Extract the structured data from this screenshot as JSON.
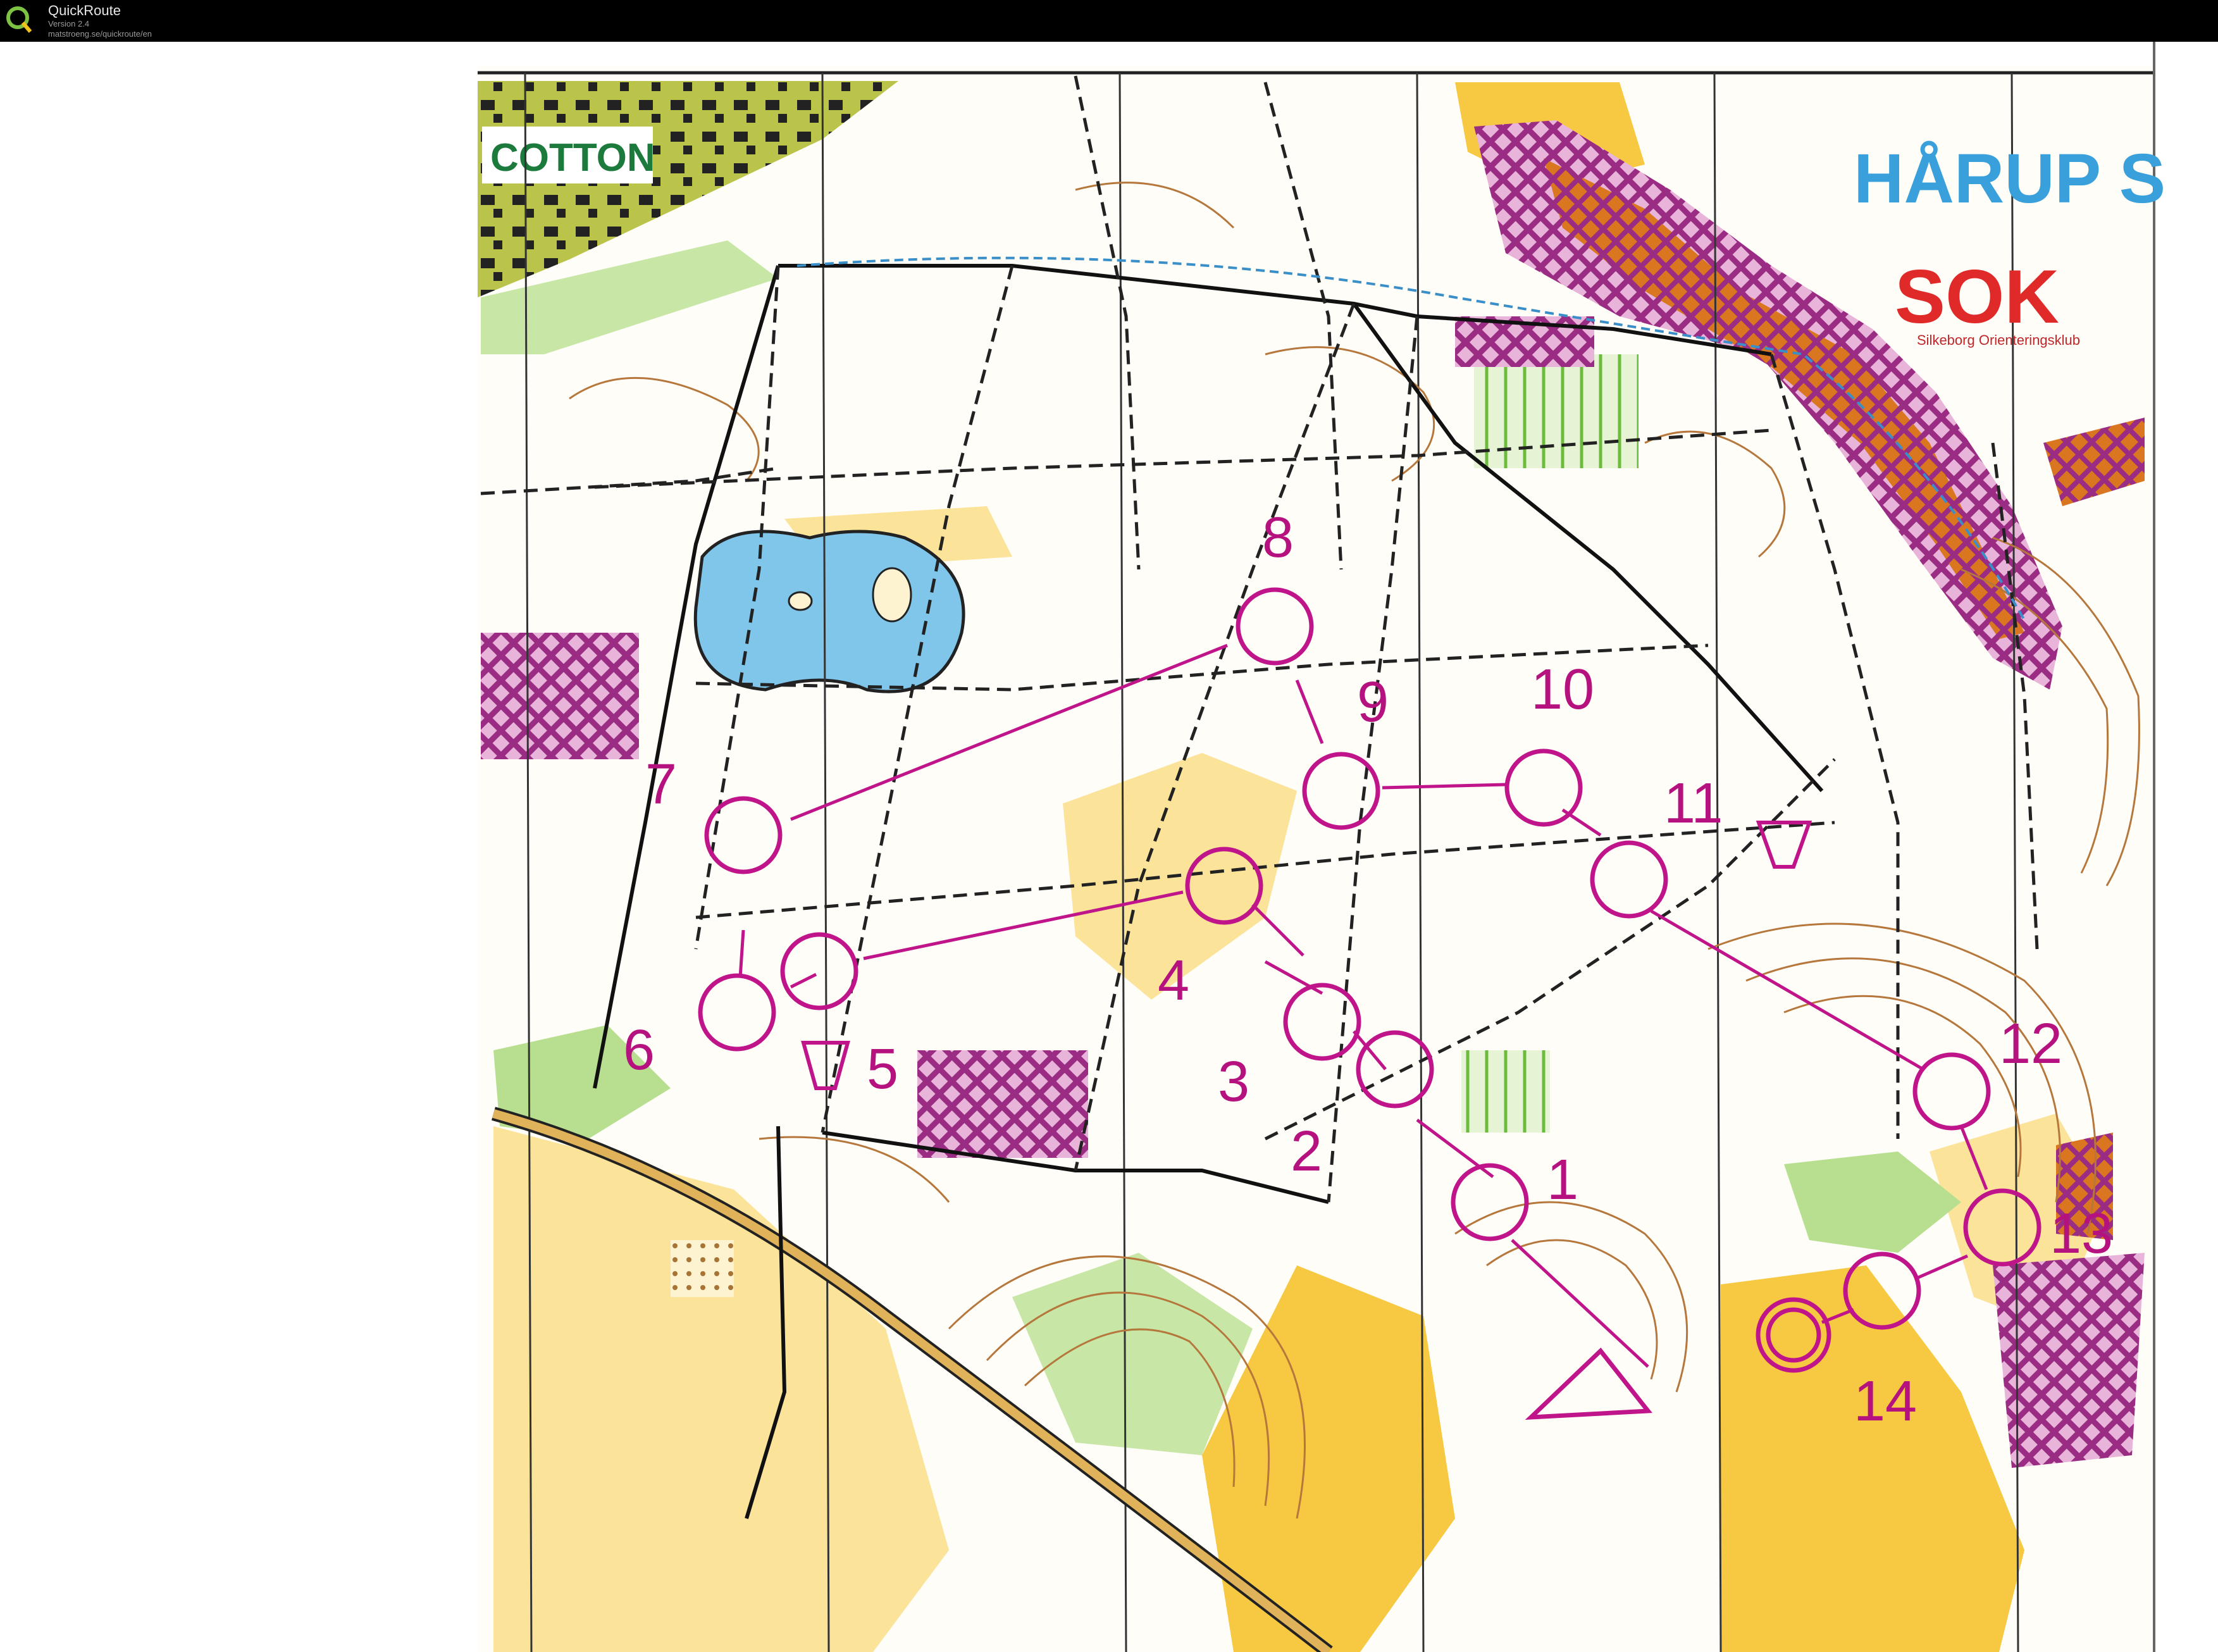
{
  "app": {
    "name": "QuickRoute",
    "version": "Version 2.4",
    "url": "matstroeng.se/quickroute/en"
  },
  "map": {
    "title": "HÅRUP S",
    "sponsor": "COTTON",
    "club_logo": "SOK",
    "club_name": "Silkeborg Orienteringsklub",
    "course_color": "#c0158a",
    "controls": [
      {
        "label": "1"
      },
      {
        "label": "2"
      },
      {
        "label": "3"
      },
      {
        "label": "4"
      },
      {
        "label": "5"
      },
      {
        "label": "6"
      },
      {
        "label": "7"
      },
      {
        "label": "8"
      },
      {
        "label": "9"
      },
      {
        "label": "10"
      },
      {
        "label": "11"
      },
      {
        "label": "12"
      },
      {
        "label": "13"
      },
      {
        "label": "14"
      }
    ]
  }
}
